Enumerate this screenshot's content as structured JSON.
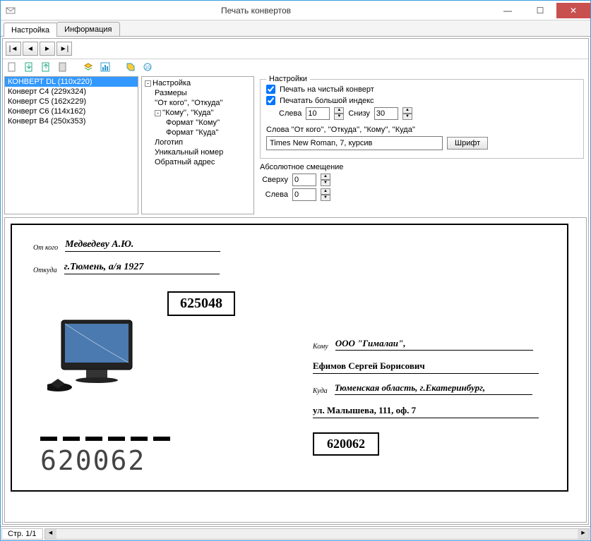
{
  "window": {
    "title": "Печать конвертов"
  },
  "tabs": {
    "settings": "Настройка",
    "info": "Информация"
  },
  "formats": {
    "items": [
      "КОНВЕРТ DL (110x220)",
      "Конверт C4 (229x324)",
      "Конверт C5 (162x229)",
      "Конверт C6 (114x162)",
      "Конверт B4 (250x353)"
    ],
    "selected": 0
  },
  "tree": {
    "root": "Настройка",
    "sizes": "Размеры",
    "from": "''От кого'', ''Откуда''",
    "to": "''Кому'', ''Куда''",
    "fmt_to": "Формат ''Кому''",
    "fmt_where": "Формат ''Куда''",
    "logo": "Логотип",
    "uniq": "Уникальный номер",
    "return": "Обратный адрес"
  },
  "settings": {
    "panel_title": "Настройки",
    "chk_clean": "Печать на чистый конверт",
    "chk_bigindex": "Печатать большой индекс",
    "left_lbl": "Слева",
    "left_val": "10",
    "bottom_lbl": "Снизу",
    "bottom_val": "30",
    "words_lbl": "Слова ''От кого'', ''Откуда'', ''Кому'', ''Куда''",
    "font_value": "Times New Roman, 7, курсив",
    "font_btn": "Шрифт",
    "abs_lbl": "Абсолютное смещение",
    "top_lbl": "Сверху",
    "top_val": "0",
    "left2_lbl": "Слева",
    "left2_val": "0"
  },
  "envelope": {
    "from_lbl": "От кого",
    "from_val": "Медведеву А.Ю.",
    "fromaddr_lbl": "Откуда",
    "fromaddr_val": "г.Тюмень, а/я 1927",
    "from_index": "625048",
    "to_lbl": "Кому",
    "to_val": "ООО \"Гималаи\",",
    "to_name2": "Ефимов Сергей Борисович",
    "where_lbl": "Куда",
    "where_val": "Тюменская область, г.Екатеринбург,",
    "where_val2": "ул. Малышева, 111, оф. 7",
    "to_index": "620062",
    "postal_digits": "620062"
  },
  "status": {
    "page": "Стр. 1/1"
  }
}
